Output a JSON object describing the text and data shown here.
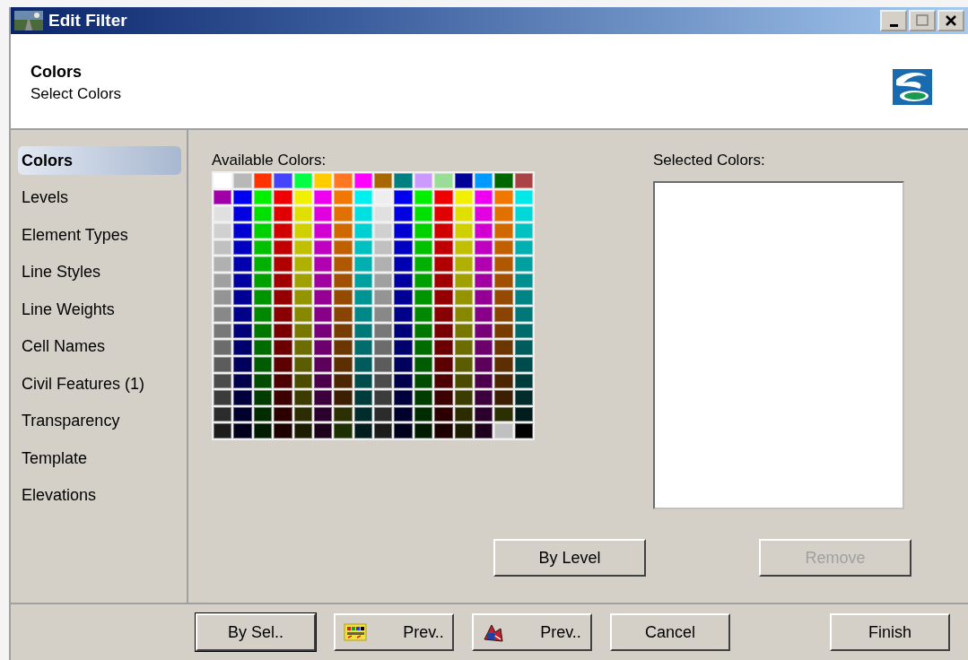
{
  "window": {
    "title": "Edit Filter"
  },
  "header": {
    "title": "Colors",
    "subtitle": "Select Colors"
  },
  "sidebar": {
    "items": [
      {
        "label": "Colors",
        "selected": true
      },
      {
        "label": "Levels",
        "selected": false
      },
      {
        "label": "Element Types",
        "selected": false
      },
      {
        "label": "Line Styles",
        "selected": false
      },
      {
        "label": "Line Weights",
        "selected": false
      },
      {
        "label": "Cell Names",
        "selected": false
      },
      {
        "label": "Civil Features (1)",
        "selected": false
      },
      {
        "label": "Transparency",
        "selected": false
      },
      {
        "label": "Template",
        "selected": false
      },
      {
        "label": "Elevations",
        "selected": false
      }
    ]
  },
  "available_colors": {
    "label": "Available Colors:",
    "rows": [
      [
        {
          "color": "#ffffff"
        },
        {
          "color": "#b8b8b8"
        },
        {
          "color": "#ff3300"
        },
        {
          "color": "#4444ff"
        },
        {
          "color": "#00ff44"
        },
        {
          "color": "#ffcc00"
        },
        {
          "color": "#ff7722"
        },
        {
          "color": "#ff00ff"
        },
        {
          "color": "#a86800"
        },
        {
          "color": "#008080"
        },
        {
          "color": "#cc99ff"
        },
        {
          "color": "#99dd99"
        },
        {
          "color": "#000099"
        },
        {
          "color": "#0099ff"
        },
        {
          "color": "#006600"
        },
        {
          "color": "#aa4444"
        }
      ],
      [
        {
          "color": "#a000a8"
        },
        {
          "color": "#0000f0"
        },
        {
          "color": "#00f000"
        },
        {
          "color": "#f00000"
        },
        {
          "color": "#f0f000"
        },
        {
          "color": "#f000f0"
        },
        {
          "color": "#f07800"
        },
        {
          "color": "#00f0f0"
        },
        {
          "color": "#eeeeee"
        },
        {
          "color": "#0000f0"
        },
        {
          "color": "#00f000"
        },
        {
          "color": "#f00000"
        },
        {
          "color": "#f0f000"
        },
        {
          "color": "#f000f0"
        },
        {
          "color": "#f07800"
        },
        {
          "color": "#00e8e8"
        }
      ],
      [
        {
          "color": "#e0e0e0"
        },
        {
          "color": "#0000e0"
        },
        {
          "color": "#00e000"
        },
        {
          "color": "#e00000"
        },
        {
          "color": "#e0e000"
        },
        {
          "color": "#e000e0"
        },
        {
          "color": "#e07000"
        },
        {
          "color": "#00e0e0"
        },
        {
          "color": "#e0e0e0"
        },
        {
          "color": "#0000e0"
        },
        {
          "color": "#00e000"
        },
        {
          "color": "#e00000"
        },
        {
          "color": "#e0e000"
        },
        {
          "color": "#e000e0"
        },
        {
          "color": "#e07000"
        },
        {
          "color": "#00d8d8"
        }
      ],
      [
        {
          "color": "#d0d0d0"
        },
        {
          "color": "#0000d0"
        },
        {
          "color": "#00d000"
        },
        {
          "color": "#d00000"
        },
        {
          "color": "#d0d000"
        },
        {
          "color": "#d000d0"
        },
        {
          "color": "#d06800"
        },
        {
          "color": "#00d0d0"
        },
        {
          "color": "#d0d0d0"
        },
        {
          "color": "#0000d0"
        },
        {
          "color": "#00d000"
        },
        {
          "color": "#d00000"
        },
        {
          "color": "#d0d000"
        },
        {
          "color": "#d000d0"
        },
        {
          "color": "#d06800"
        },
        {
          "color": "#00c0c0"
        }
      ],
      [
        {
          "color": "#c0c0c0"
        },
        {
          "color": "#0000c0"
        },
        {
          "color": "#00c000"
        },
        {
          "color": "#c00000"
        },
        {
          "color": "#c0c000"
        },
        {
          "color": "#c000c0"
        },
        {
          "color": "#c06000"
        },
        {
          "color": "#00c0c0"
        },
        {
          "color": "#c0c0c0"
        },
        {
          "color": "#0000c0"
        },
        {
          "color": "#00c000"
        },
        {
          "color": "#c00000"
        },
        {
          "color": "#c0c000"
        },
        {
          "color": "#c000c0"
        },
        {
          "color": "#c06000"
        },
        {
          "color": "#00b0b0"
        }
      ],
      [
        {
          "color": "#b0b0b0"
        },
        {
          "color": "#0000b0"
        },
        {
          "color": "#00b000"
        },
        {
          "color": "#b00000"
        },
        {
          "color": "#b0b000"
        },
        {
          "color": "#b000b0"
        },
        {
          "color": "#b05800"
        },
        {
          "color": "#00b0b0"
        },
        {
          "color": "#b0b0b0"
        },
        {
          "color": "#0000b0"
        },
        {
          "color": "#00b000"
        },
        {
          "color": "#b00000"
        },
        {
          "color": "#b0b000"
        },
        {
          "color": "#b000b0"
        },
        {
          "color": "#b05800"
        },
        {
          "color": "#00a0a0"
        }
      ],
      [
        {
          "color": "#a0a0a0"
        },
        {
          "color": "#0000a0"
        },
        {
          "color": "#00a000"
        },
        {
          "color": "#a00000"
        },
        {
          "color": "#a0a000"
        },
        {
          "color": "#a000a0"
        },
        {
          "color": "#a05000"
        },
        {
          "color": "#00a0a0"
        },
        {
          "color": "#a0a0a0"
        },
        {
          "color": "#0000a0"
        },
        {
          "color": "#00a000"
        },
        {
          "color": "#a00000"
        },
        {
          "color": "#a0a000"
        },
        {
          "color": "#a000a0"
        },
        {
          "color": "#a05000"
        },
        {
          "color": "#009090"
        }
      ],
      [
        {
          "color": "#949494"
        },
        {
          "color": "#000094"
        },
        {
          "color": "#009400"
        },
        {
          "color": "#940000"
        },
        {
          "color": "#949400"
        },
        {
          "color": "#940094"
        },
        {
          "color": "#944a00"
        },
        {
          "color": "#009494"
        },
        {
          "color": "#949494"
        },
        {
          "color": "#000094"
        },
        {
          "color": "#009400"
        },
        {
          "color": "#940000"
        },
        {
          "color": "#949400"
        },
        {
          "color": "#940094"
        },
        {
          "color": "#944a00"
        },
        {
          "color": "#008484"
        }
      ],
      [
        {
          "color": "#888888"
        },
        {
          "color": "#000088"
        },
        {
          "color": "#008800"
        },
        {
          "color": "#880000"
        },
        {
          "color": "#888800"
        },
        {
          "color": "#880088"
        },
        {
          "color": "#884400"
        },
        {
          "color": "#008888"
        },
        {
          "color": "#888888"
        },
        {
          "color": "#000088"
        },
        {
          "color": "#008800"
        },
        {
          "color": "#880000"
        },
        {
          "color": "#888800"
        },
        {
          "color": "#880088"
        },
        {
          "color": "#884400"
        },
        {
          "color": "#007878"
        }
      ],
      [
        {
          "color": "#787878"
        },
        {
          "color": "#000078"
        },
        {
          "color": "#007800"
        },
        {
          "color": "#780000"
        },
        {
          "color": "#787800"
        },
        {
          "color": "#780078"
        },
        {
          "color": "#783c00"
        },
        {
          "color": "#007878"
        },
        {
          "color": "#787878"
        },
        {
          "color": "#000078"
        },
        {
          "color": "#007800"
        },
        {
          "color": "#780000"
        },
        {
          "color": "#787800"
        },
        {
          "color": "#780078"
        },
        {
          "color": "#783c00"
        },
        {
          "color": "#006c6c"
        }
      ],
      [
        {
          "color": "#6c6c6c"
        },
        {
          "color": "#00006c"
        },
        {
          "color": "#006c00"
        },
        {
          "color": "#6c0000"
        },
        {
          "color": "#6c6c00"
        },
        {
          "color": "#6c006c"
        },
        {
          "color": "#6c3600"
        },
        {
          "color": "#006c6c"
        },
        {
          "color": "#6c6c6c"
        },
        {
          "color": "#00006c"
        },
        {
          "color": "#006c00"
        },
        {
          "color": "#6c0000"
        },
        {
          "color": "#6c6c00"
        },
        {
          "color": "#6c006c"
        },
        {
          "color": "#6c3600"
        },
        {
          "color": "#005c5c"
        }
      ],
      [
        {
          "color": "#5c5c5c"
        },
        {
          "color": "#00005c"
        },
        {
          "color": "#005c00"
        },
        {
          "color": "#5c0000"
        },
        {
          "color": "#5c5c00"
        },
        {
          "color": "#5c005c"
        },
        {
          "color": "#5c2e00"
        },
        {
          "color": "#005c5c"
        },
        {
          "color": "#5c5c5c"
        },
        {
          "color": "#00005c"
        },
        {
          "color": "#005c00"
        },
        {
          "color": "#5c0000"
        },
        {
          "color": "#5c5c00"
        },
        {
          "color": "#5c005c"
        },
        {
          "color": "#5c2e00"
        },
        {
          "color": "#004c4c"
        }
      ],
      [
        {
          "color": "#4c4c4c"
        },
        {
          "color": "#00004c"
        },
        {
          "color": "#004c00"
        },
        {
          "color": "#4c0000"
        },
        {
          "color": "#4c4c00"
        },
        {
          "color": "#4c004c"
        },
        {
          "color": "#4c2600"
        },
        {
          "color": "#004c4c"
        },
        {
          "color": "#4c4c4c"
        },
        {
          "color": "#00004c"
        },
        {
          "color": "#004c00"
        },
        {
          "color": "#4c0000"
        },
        {
          "color": "#4c4c00"
        },
        {
          "color": "#4c004c"
        },
        {
          "color": "#4c2600"
        },
        {
          "color": "#003c3c"
        }
      ],
      [
        {
          "color": "#3c3c3c"
        },
        {
          "color": "#00003c"
        },
        {
          "color": "#003c00"
        },
        {
          "color": "#3c0000"
        },
        {
          "color": "#3c3c00"
        },
        {
          "color": "#3c003c"
        },
        {
          "color": "#3c1e00"
        },
        {
          "color": "#003c3c"
        },
        {
          "color": "#3c3c3c"
        },
        {
          "color": "#00003c"
        },
        {
          "color": "#003c00"
        },
        {
          "color": "#3c0000"
        },
        {
          "color": "#3c3c00"
        },
        {
          "color": "#3c003c"
        },
        {
          "color": "#3c1e00"
        },
        {
          "color": "#002c2c"
        }
      ],
      [
        {
          "color": "#2c2c2c"
        },
        {
          "color": "#00002c"
        },
        {
          "color": "#002c00"
        },
        {
          "color": "#2c0000"
        },
        {
          "color": "#2c2c00"
        },
        {
          "color": "#2c002c"
        },
        {
          "color": "#2c3000"
        },
        {
          "color": "#002c2c"
        },
        {
          "color": "#2c2c2c"
        },
        {
          "color": "#00002c"
        },
        {
          "color": "#002c00"
        },
        {
          "color": "#2c0000"
        },
        {
          "color": "#2c2c00"
        },
        {
          "color": "#2c002c"
        },
        {
          "color": "#2c3000"
        },
        {
          "color": "#001c1c"
        }
      ],
      [
        {
          "color": "#1c1c1c"
        },
        {
          "color": "#00001c"
        },
        {
          "color": "#001c00"
        },
        {
          "color": "#1c0000"
        },
        {
          "color": "#1c1c00"
        },
        {
          "color": "#1c001c"
        },
        {
          "color": "#1c3000"
        },
        {
          "color": "#001c1c"
        },
        {
          "color": "#1c1c1c"
        },
        {
          "color": "#00001c"
        },
        {
          "color": "#001c00"
        },
        {
          "color": "#1c0000"
        },
        {
          "color": "#1c1c00"
        },
        {
          "color": "#1c001c"
        },
        {
          "color": "#c0c0c0"
        },
        {
          "color": "#000000"
        }
      ]
    ]
  },
  "selected_colors": {
    "label": "Selected Colors:"
  },
  "actions": [
    {
      "label": "By Level",
      "disabled": false
    },
    {
      "label": "Remove",
      "disabled": true
    }
  ],
  "footer_buttons": [
    {
      "label": "By Sel..",
      "kind": "plain",
      "default": true
    },
    {
      "label": "Prev..",
      "kind": "palette",
      "default": false
    },
    {
      "label": "Prev..",
      "kind": "drawing",
      "default": false
    },
    {
      "label": "Cancel",
      "kind": "plain",
      "default": false
    },
    {
      "label": "Finish",
      "kind": "plain",
      "default": false
    }
  ]
}
